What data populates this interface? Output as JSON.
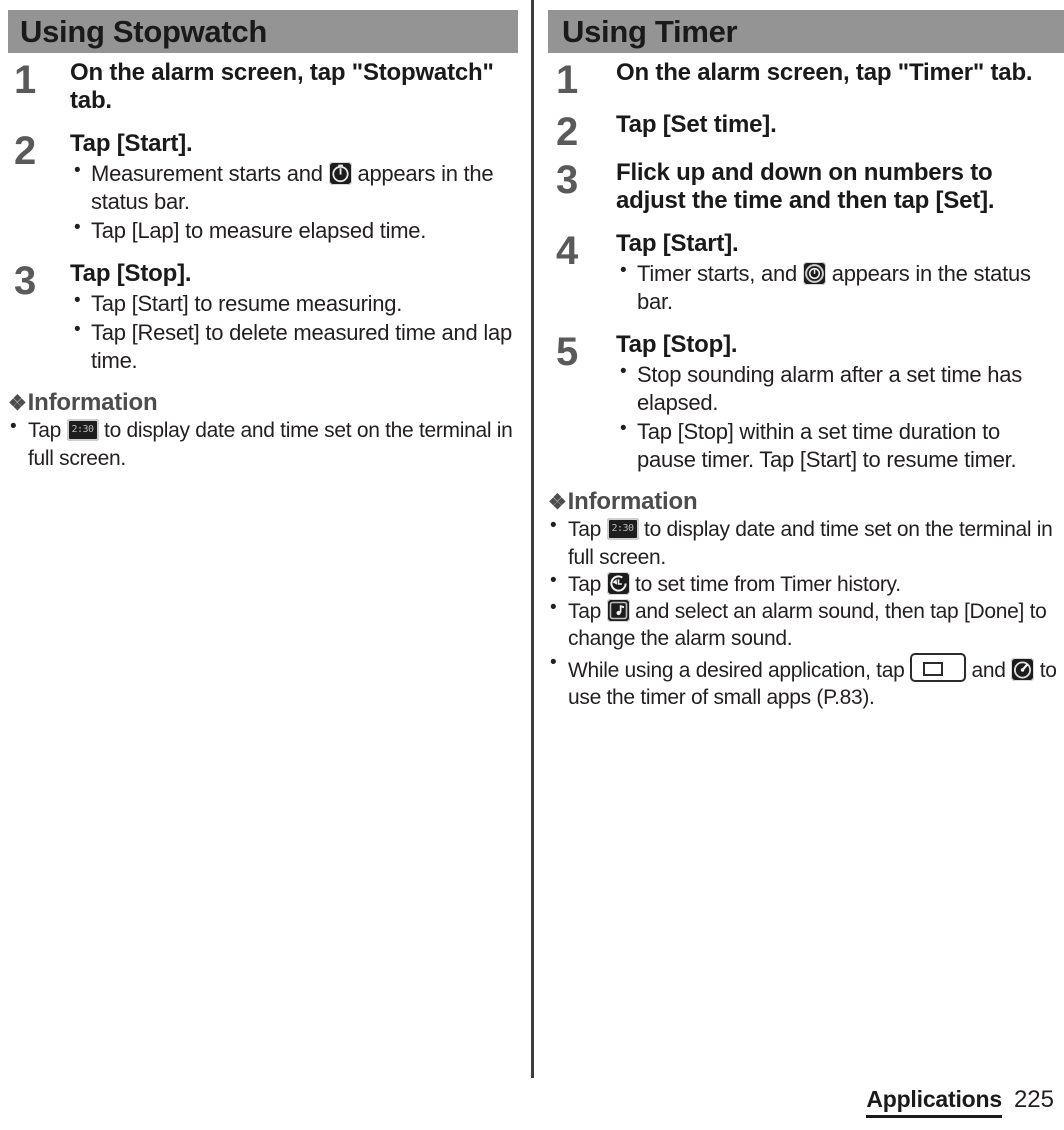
{
  "left_column": {
    "section_title": "Using Stopwatch",
    "steps": [
      {
        "number": "1",
        "title": "On the alarm screen, tap \"Stopwatch\" tab.",
        "bullets": []
      },
      {
        "number": "2",
        "title": "Tap [Start].",
        "bullets": [
          {
            "before": "Measurement starts and ",
            "icon": "stopwatch-status-icon",
            "after": " appears in the status bar."
          },
          {
            "before": "Tap [Lap] to measure elapsed time.",
            "icon": null,
            "after": ""
          }
        ]
      },
      {
        "number": "3",
        "title": "Tap [Stop].",
        "bullets": [
          {
            "before": "Tap [Start] to resume measuring.",
            "icon": null,
            "after": ""
          },
          {
            "before": "Tap [Reset] to delete measured time and lap time.",
            "icon": null,
            "after": ""
          }
        ]
      }
    ],
    "information": {
      "heading": "Information",
      "diamond": "❖",
      "items": [
        {
          "before": "Tap ",
          "icon": "digital-clock-icon",
          "icon_text": "2:30",
          "after": " to display date and time set on the terminal in full screen."
        }
      ]
    }
  },
  "right_column": {
    "section_title": "Using Timer",
    "steps": [
      {
        "number": "1",
        "title": "On the alarm screen, tap \"Timer\" tab.",
        "bullets": []
      },
      {
        "number": "2",
        "title": "Tap [Set time].",
        "bullets": []
      },
      {
        "number": "3",
        "title": "Flick up and down on numbers to adjust the time and then tap [Set].",
        "bullets": []
      },
      {
        "number": "4",
        "title": "Tap [Start].",
        "bullets": [
          {
            "before": "Timer starts, and ",
            "icon": "timer-status-icon",
            "after": " appears in the status bar."
          }
        ]
      },
      {
        "number": "5",
        "title": "Tap [Stop].",
        "bullets": [
          {
            "before": "Stop sounding alarm after a set time has elapsed.",
            "icon": null,
            "after": ""
          },
          {
            "before": "Tap [Stop] within a set time duration to pause timer. Tap [Start] to resume timer.",
            "icon": null,
            "after": ""
          }
        ]
      }
    ],
    "information": {
      "heading": "Information",
      "diamond": "❖",
      "items": [
        {
          "before": "Tap ",
          "icon": "digital-clock-icon",
          "icon_text": "2:30",
          "after": " to display date and time set on the terminal in full screen."
        },
        {
          "before": "Tap ",
          "icon": "timer-history-icon",
          "after": " to set time from Timer history."
        },
        {
          "before": "Tap ",
          "icon": "alarm-sound-icon",
          "after": " and select an alarm sound, then tap [Done] to change the alarm sound."
        },
        {
          "before": "While using a desired application, tap ",
          "icon": "recent-apps-key-icon",
          "middle": " and ",
          "icon2": "small-apps-timer-icon",
          "after": " to use the timer of small apps (P.83)."
        }
      ]
    }
  },
  "footer": {
    "section_label": "Applications",
    "page_number": "225"
  },
  "colors": {
    "header_bar": "#949494",
    "step_number": "#5a5a5a",
    "body_text": "#231f20",
    "info_heading": "#4d4d4d",
    "divider": "#3d3d3d",
    "icon_badge": "#1c1c1c"
  }
}
